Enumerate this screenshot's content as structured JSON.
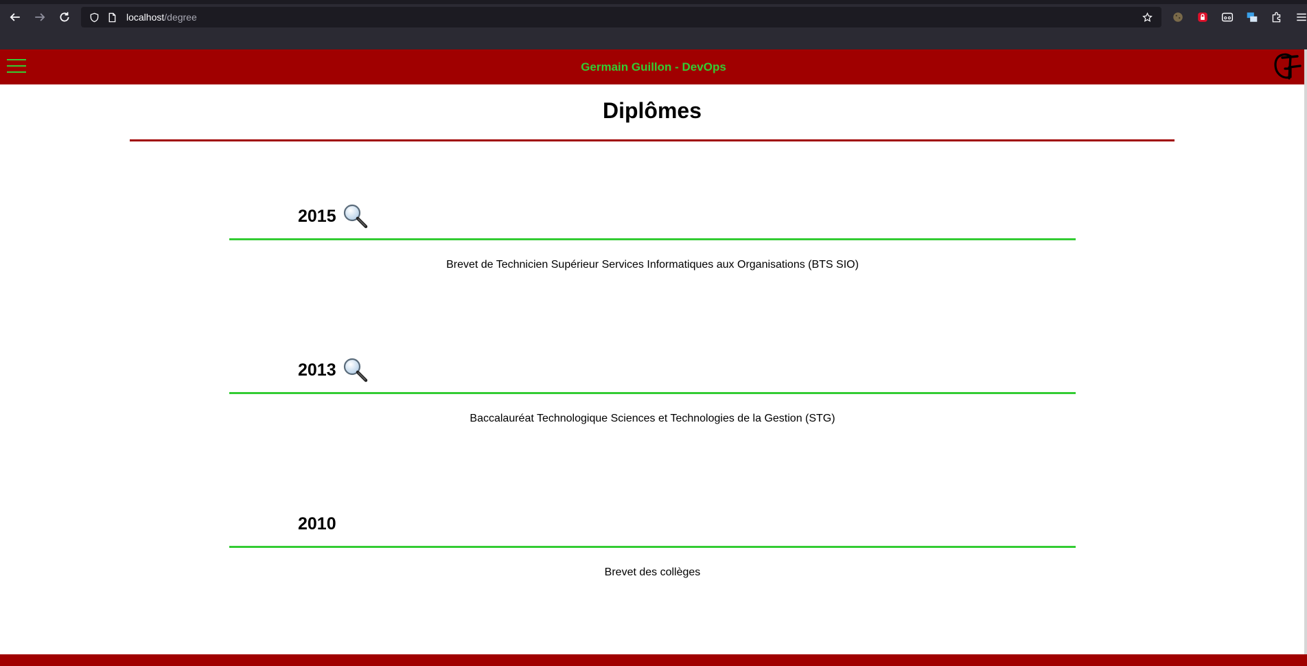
{
  "browser": {
    "url_host": "localhost",
    "url_path": "/degree"
  },
  "header": {
    "title": "Germain Guillon - DevOps"
  },
  "page": {
    "title": "Diplômes"
  },
  "degrees": [
    {
      "year": "2015",
      "has_details": true,
      "description": "Brevet de Technicien Supérieur Services Informatiques aux Organisations (BTS SIO)"
    },
    {
      "year": "2013",
      "has_details": true,
      "description": "Baccalauréat Technologique Sciences et Technologies de la Gestion (STG)"
    },
    {
      "year": "2010",
      "has_details": false,
      "description": "Brevet des collèges"
    }
  ],
  "colors": {
    "brand_red": "#a00000",
    "accent_green": "#33cc33"
  }
}
